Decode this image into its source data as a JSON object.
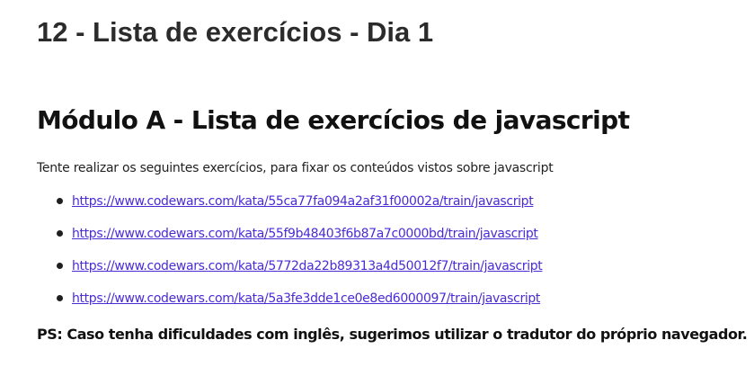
{
  "page": {
    "title": "12 - Lista de exercícios - Dia 1"
  },
  "section": {
    "title": "Módulo A - Lista de exercícios de javascript",
    "intro": "Tente realizar os seguintes exercícios, para fixar os conteúdos vistos sobre javascript",
    "links": [
      "https://www.codewars.com/kata/55ca77fa094a2af31f00002a/train/javascript",
      "https://www.codewars.com/kata/55f9b48403f6b87a7c0000bd/train/javascript",
      "https://www.codewars.com/kata/5772da22b89313a4d50012f7/train/javascript",
      "https://www.codewars.com/kata/5a3fe3dde1ce0e8ed6000097/train/javascript"
    ],
    "ps": "PS: Caso tenha dificuldades com inglês, sugerimos utilizar o tradutor do próprio navegador."
  },
  "colors": {
    "link": "#4a2bd6",
    "text": "#1f1f1f"
  }
}
